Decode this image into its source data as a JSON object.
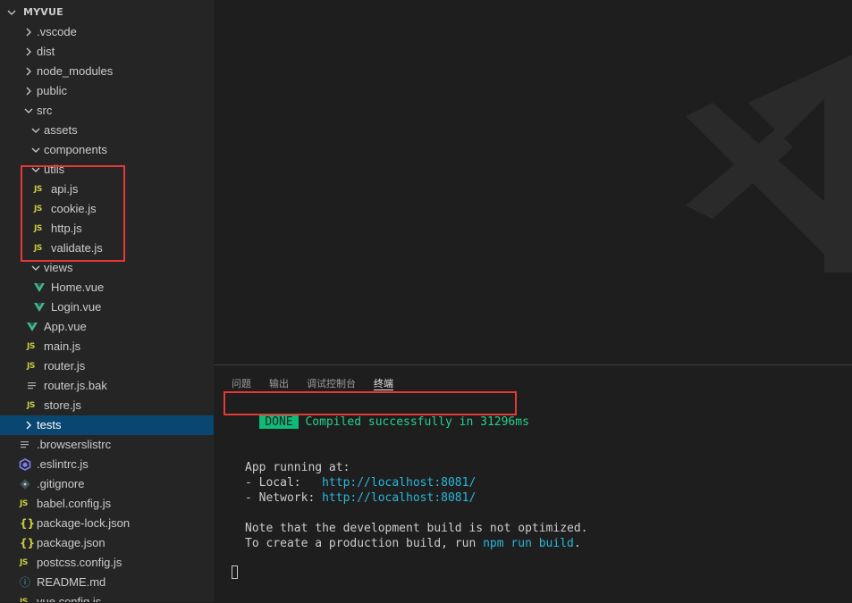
{
  "explorer": {
    "title": "MYVUE",
    "items": [
      {
        "label": ".vscode",
        "kind": "folder",
        "expanded": false
      },
      {
        "label": "dist",
        "kind": "folder",
        "expanded": false
      },
      {
        "label": "node_modules",
        "kind": "folder",
        "expanded": false
      },
      {
        "label": "public",
        "kind": "folder",
        "expanded": false
      },
      {
        "label": "src",
        "kind": "folder",
        "expanded": true
      },
      {
        "label": "assets",
        "kind": "folder",
        "expanded": true
      },
      {
        "label": "components",
        "kind": "folder",
        "expanded": true
      },
      {
        "label": "utils",
        "kind": "folder",
        "expanded": true
      },
      {
        "label": "api.js",
        "kind": "js",
        "icon_text": "JS"
      },
      {
        "label": "cookie.js",
        "kind": "js",
        "icon_text": "JS"
      },
      {
        "label": "http.js",
        "kind": "js",
        "icon_text": "JS"
      },
      {
        "label": "validate.js",
        "kind": "js",
        "icon_text": "JS"
      },
      {
        "label": "views",
        "kind": "folder",
        "expanded": true
      },
      {
        "label": "Home.vue",
        "kind": "vue"
      },
      {
        "label": "Login.vue",
        "kind": "vue"
      },
      {
        "label": "App.vue",
        "kind": "vue"
      },
      {
        "label": "main.js",
        "kind": "js",
        "icon_text": "JS"
      },
      {
        "label": "router.js",
        "kind": "js",
        "icon_text": "JS"
      },
      {
        "label": "router.js.bak",
        "kind": "text"
      },
      {
        "label": "store.js",
        "kind": "js",
        "icon_text": "JS"
      },
      {
        "label": "tests",
        "kind": "folder",
        "expanded": false,
        "selected": true
      },
      {
        "label": ".browserslistrc",
        "kind": "text"
      },
      {
        "label": ".eslintrc.js",
        "kind": "eslint"
      },
      {
        "label": ".gitignore",
        "kind": "git"
      },
      {
        "label": "babel.config.js",
        "kind": "js",
        "icon_text": "JS"
      },
      {
        "label": "package-lock.json",
        "kind": "json",
        "icon_text": "{}"
      },
      {
        "label": "package.json",
        "kind": "json",
        "icon_text": "{}"
      },
      {
        "label": "postcss.config.js",
        "kind": "js",
        "icon_text": "JS"
      },
      {
        "label": "README.md",
        "kind": "info",
        "icon_text": "ⓘ"
      },
      {
        "label": "vue.config.js",
        "kind": "js",
        "icon_text": "JS"
      }
    ]
  },
  "panel": {
    "tabs": [
      {
        "label": "问题",
        "active": false
      },
      {
        "label": "输出",
        "active": false
      },
      {
        "label": "调试控制台",
        "active": false
      },
      {
        "label": "终端",
        "active": true
      }
    ]
  },
  "terminal": {
    "done_badge": "DONE",
    "done_message": "Compiled successfully in 31296ms",
    "app_running": "App running at:",
    "local_label": "- Local:   ",
    "local_url": "http://localhost:8081/",
    "network_label": "- Network: ",
    "network_url": "http://localhost:8081/",
    "note_line1": "Note that the development build is not optimized.",
    "note_line2_prefix": "To create a production build, run ",
    "note_line2_cmd": "npm run build",
    "note_line2_suffix": "."
  },
  "colors": {
    "sidebar_bg": "#252526",
    "editor_bg": "#1e1e1e",
    "selection": "#094771",
    "highlight_box": "#e53935",
    "done_green": "#23d18b",
    "link_cyan": "#29b8db",
    "js_yellow": "#cbcb41",
    "vue_green": "#41b883"
  }
}
